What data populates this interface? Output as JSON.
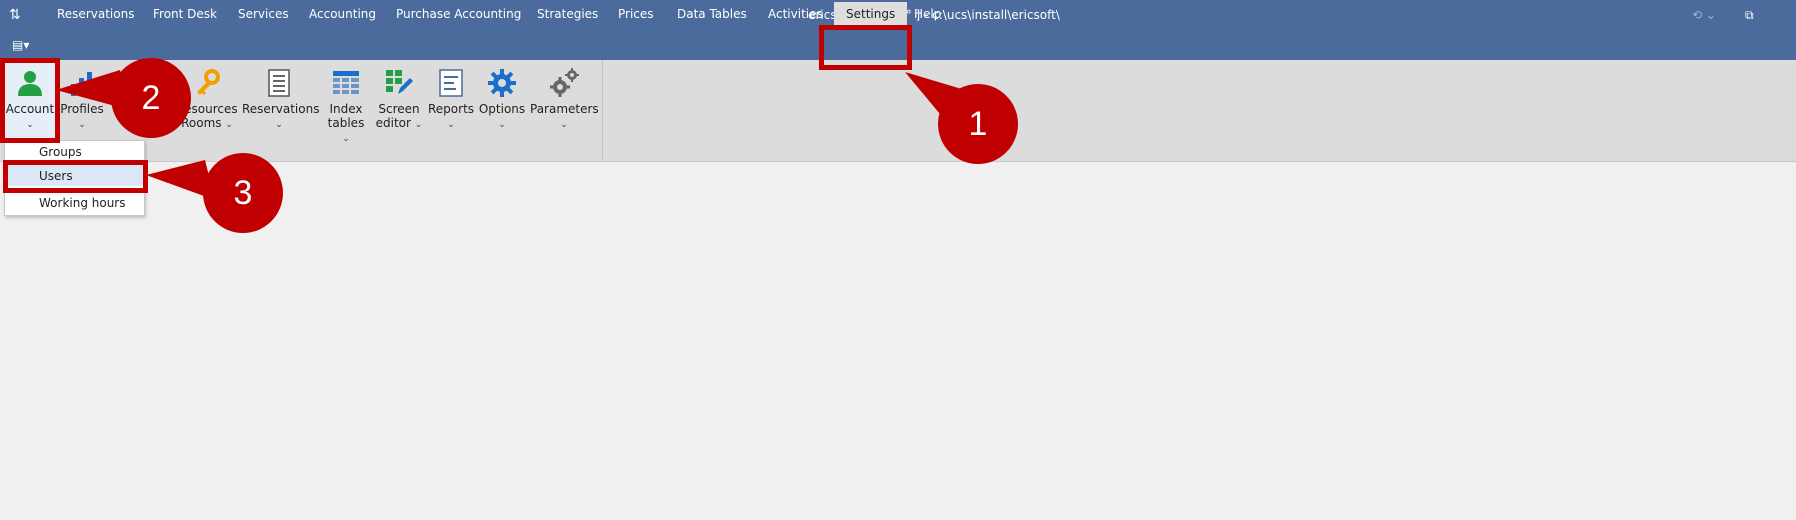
{
  "titlebar": {
    "title": "ericsoft [ suite 5° ] - c:\\ucs\\install\\ericsoft\\",
    "app_glyph": "⇅",
    "restore_glyph": "⧉",
    "swap_glyph": "⟲ ⌄"
  },
  "menubar": {
    "doc_glyph": "▤▾",
    "tabs": [
      "Reservations",
      "Front Desk",
      "Services",
      "Accounting",
      "Purchase Accounting",
      "Strategies",
      "Prices",
      "Data Tables",
      "Activities",
      "Settings",
      "Help"
    ],
    "active_tab": "Settings"
  },
  "ribbon": {
    "buttons": [
      {
        "label1": "Account",
        "label2": "",
        "icon": "user-icon"
      },
      {
        "label1": "Profiles",
        "label2": "",
        "icon": "bar-chart-icon"
      },
      {
        "label1": "Resources",
        "label2": "Rooms",
        "icon": "key-icon"
      },
      {
        "label1": "Reservations",
        "label2": "",
        "icon": "document-list-icon"
      },
      {
        "label1": "Index",
        "label2": "tables",
        "icon": "table-icon"
      },
      {
        "label1": "Screen",
        "label2": "editor",
        "icon": "grid-edit-icon"
      },
      {
        "label1": "Reports",
        "label2": "",
        "icon": "report-icon"
      },
      {
        "label1": "Options",
        "label2": "",
        "icon": "gear-icon"
      },
      {
        "label1": "Parameters",
        "label2": "",
        "icon": "gears-icon"
      }
    ],
    "chevron": "⌄"
  },
  "account_menu": {
    "items": [
      "Groups",
      "Users",
      "Working hours"
    ],
    "highlighted": "Users"
  },
  "callouts": [
    "1",
    "2",
    "3"
  ],
  "colors": {
    "titlebar": "#4b6b9c",
    "ribbon": "#dcdcdc",
    "highlight": "#c00000",
    "user_icon": "#22a046",
    "gear_icon": "#1a6fc9"
  }
}
